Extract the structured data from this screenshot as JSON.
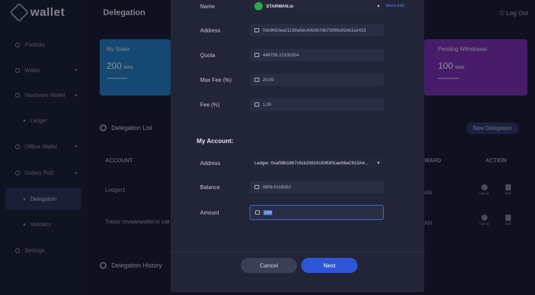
{
  "app": {
    "title": "wallet"
  },
  "sidebar": {
    "items": [
      {
        "label": "Portfolio"
      },
      {
        "label": "Wallet"
      },
      {
        "label": "Hardware Wallet"
      },
      {
        "label": "Ledger"
      },
      {
        "label": "Offline Wallet"
      },
      {
        "label": "Galaxy PoS"
      },
      {
        "label": "Delegation"
      },
      {
        "label": "Validator"
      },
      {
        "label": "Settings"
      }
    ]
  },
  "header": {
    "title": "Delegation",
    "logout": "Log Out"
  },
  "cards": {
    "my_stake": {
      "label": "My Stake",
      "value": "200",
      "unit": "WAN"
    },
    "pending": {
      "label": "Pending Withdrawal",
      "value": "100",
      "unit": "WAN"
    }
  },
  "delegation_list": {
    "title": "Delegation List",
    "new_button": "New Delegation",
    "columns": {
      "account": "ACCOUNT",
      "reward": "WARD",
      "action": "ACTION"
    },
    "rows": [
      {
        "account": "Ledger1",
        "reward": "AN"
      },
      {
        "account": "Trezor mywanwallet.io vali",
        "reward": "AN"
      }
    ],
    "actions": {
      "topup": "Top-up",
      "exit": "Exit"
    }
  },
  "delegation_history": {
    "title": "Delegation History"
  },
  "modal": {
    "more_info": "More Info",
    "validator": {
      "name_label": "Name",
      "name_value": "STARWAN.io",
      "address_label": "Address",
      "address_value": "0xb9650ea21158a6dc40b3b7db7399bc82eb1a1415",
      "quota_label": "Quota",
      "quota_value": "446706.12105254",
      "maxfee_label": "Max Fee (%)",
      "maxfee_value": "20.00",
      "fee_label": "Fee (%)",
      "fee_value": "1.00"
    },
    "my_account": {
      "title": "My Account:",
      "address_label": "Address",
      "address_value": "Ledger: 0xaf38b1867c0cb208161936301ae08aC615A4...",
      "balance_label": "Balance",
      "balance_value": "9909.6118352",
      "amount_label": "Amount",
      "amount_value": "100"
    },
    "cancel": "Cancel",
    "next": "Next"
  }
}
